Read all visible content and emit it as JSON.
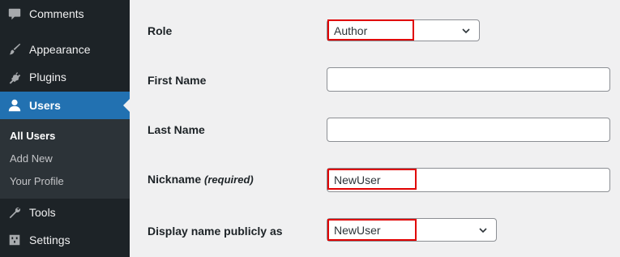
{
  "sidebar": {
    "items": [
      {
        "label": "Comments",
        "icon": "comment-icon"
      },
      {
        "label": "Appearance",
        "icon": "paintbrush-icon"
      },
      {
        "label": "Plugins",
        "icon": "plugin-icon"
      },
      {
        "label": "Users",
        "icon": "user-icon",
        "active": true
      },
      {
        "label": "Tools",
        "icon": "wrench-icon"
      },
      {
        "label": "Settings",
        "icon": "settings-icon"
      }
    ],
    "submenu": [
      "All Users",
      "Add New",
      "Your Profile"
    ]
  },
  "form": {
    "role_label": "Role",
    "role_value": "Author",
    "first_name_label": "First Name",
    "first_name_value": "",
    "last_name_label": "Last Name",
    "last_name_value": "",
    "nickname_label": "Nickname",
    "nickname_required": "(required)",
    "nickname_value": "NewUser",
    "display_name_label": "Display name publicly as",
    "display_name_value": "NewUser"
  },
  "colors": {
    "sidebar_bg": "#1d2327",
    "active_bg": "#2271b1",
    "highlight": "#e00000"
  }
}
